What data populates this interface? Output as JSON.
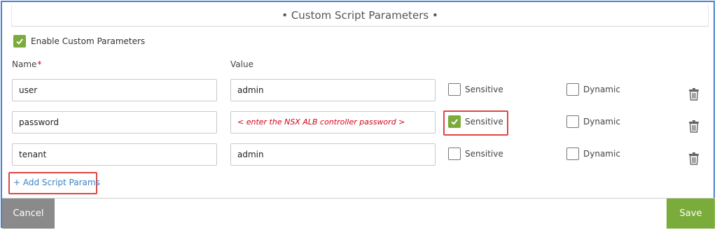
{
  "header": {
    "title": "• Custom Script Parameters •"
  },
  "enable": {
    "label": "Enable Custom Parameters",
    "checked": true
  },
  "columns": {
    "name": "Name",
    "required_mark": "*",
    "value": "Value"
  },
  "rows": [
    {
      "name": "user",
      "value": "admin",
      "sensitive_label": "Sensitive",
      "sensitive": false,
      "dynamic_label": "Dynamic",
      "dynamic": false
    },
    {
      "name": "password",
      "value": "< enter the NSX ALB controller password >",
      "sensitive_label": "Sensitive",
      "sensitive": true,
      "dynamic_label": "Dynamic",
      "dynamic": false
    },
    {
      "name": "tenant",
      "value": "admin",
      "sensitive_label": "Sensitive",
      "sensitive": false,
      "dynamic_label": "Dynamic",
      "dynamic": false
    }
  ],
  "add_params": {
    "label": "+ Add Script Params"
  },
  "footer": {
    "cancel_label": "Cancel",
    "save_label": "Save"
  },
  "colors": {
    "accent_green": "#7bab3a",
    "link_blue": "#3d82c4",
    "highlight_red": "#e04545",
    "cancel_gray": "#8a8a8a"
  }
}
